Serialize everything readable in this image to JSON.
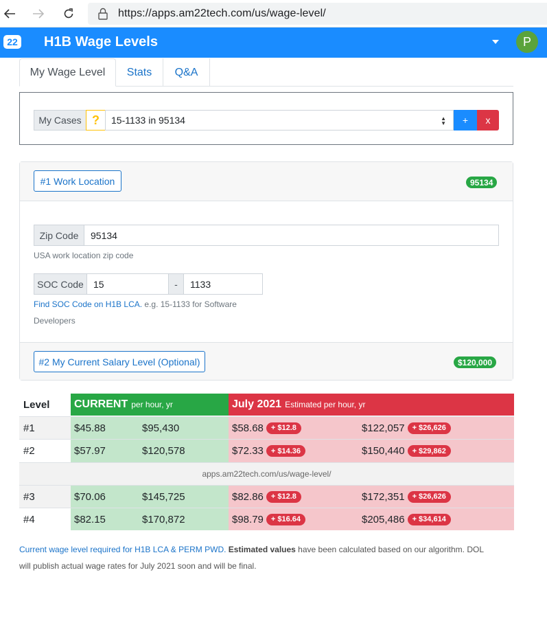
{
  "browser": {
    "url": "https://apps.am22tech.com/us/wage-level/"
  },
  "header": {
    "logo_text": "22",
    "title": "H1B Wage Levels",
    "avatar_initial": "P",
    "accent_color": "#1a8cff"
  },
  "tabs": [
    {
      "label": "My Wage Level",
      "active": true
    },
    {
      "label": "Stats",
      "active": false
    },
    {
      "label": "Q&A",
      "active": false
    }
  ],
  "cases": {
    "label": "My Cases",
    "help": "?",
    "selected": "15-1133 in 95134",
    "add": "+",
    "remove": "x"
  },
  "location": {
    "button": "#1 Work Location",
    "badge": "95134",
    "zip_label": "Zip Code",
    "zip_value": "95134",
    "zip_hint": "USA work location zip code",
    "soc_label": "SOC Code",
    "soc_part1": "15",
    "soc_sep": "-",
    "soc_part2": "1133",
    "soc_link": "Find SOC Code on H1B LCA.",
    "soc_hint_a": " e.g. 15-1133 for Software",
    "soc_hint_b": "Developers",
    "salary_button": "#2 My Current Salary Level (Optional)",
    "salary_badge": "$120,000"
  },
  "table": {
    "col_level": "Level",
    "current_title": "CURRENT",
    "current_sub": "per hour, yr",
    "est_title": "July 2021",
    "est_sub": "Estimated per hour, yr",
    "watermark": "apps.am22tech.com/us/wage-level/",
    "rows": [
      {
        "level": "#1",
        "cur_hr": "$45.88",
        "cur_yr": "$95,430",
        "est_hr": "$58.68",
        "inc_hr": "+ $12.8",
        "est_yr": "$122,057",
        "inc_yr": "+ $26,626"
      },
      {
        "level": "#2",
        "cur_hr": "$57.97",
        "cur_yr": "$120,578",
        "est_hr": "$72.33",
        "inc_hr": "+ $14.36",
        "est_yr": "$150,440",
        "inc_yr": "+ $29,862"
      },
      {
        "level": "#3",
        "cur_hr": "$70.06",
        "cur_yr": "$145,725",
        "est_hr": "$82.86",
        "inc_hr": "+ $12.8",
        "est_yr": "$172,351",
        "inc_yr": "+ $26,626"
      },
      {
        "level": "#4",
        "cur_hr": "$82.15",
        "cur_yr": "$170,872",
        "est_hr": "$98.79",
        "inc_hr": "+ $16.64",
        "est_yr": "$205,486",
        "inc_yr": "+ $34,614"
      }
    ]
  },
  "footnote": {
    "link": "Current wage level required for H1B LCA & PERM PWD.",
    "bold": "Estimated values",
    "rest1": " have been calculated based on our algorithm. DOL",
    "rest2": "will publish actual wage rates for July 2021 soon and will be final."
  }
}
